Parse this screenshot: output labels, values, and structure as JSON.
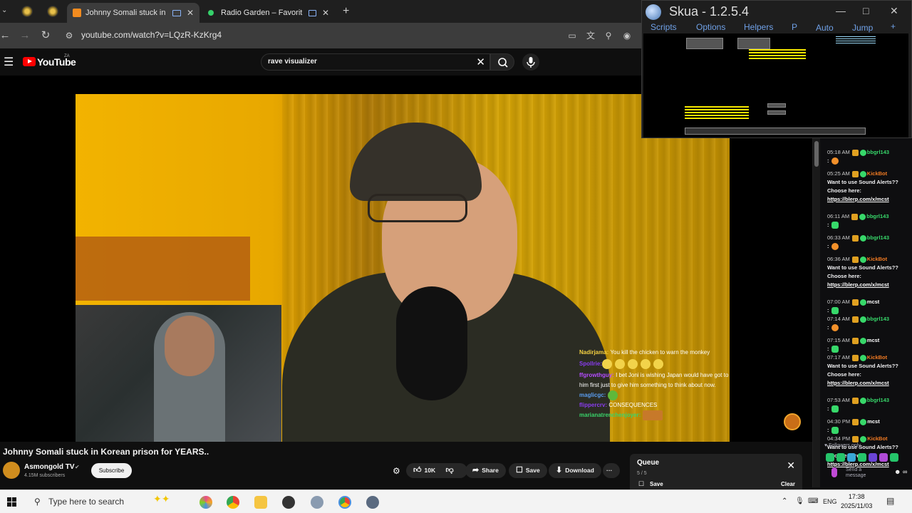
{
  "browser": {
    "tabs": [
      {
        "title": "Johnny Somali stuck in Kor",
        "active": true
      },
      {
        "title": "Radio Garden – Favorites",
        "active": false
      }
    ],
    "url": "youtube.com/watch?v=LQzR-KzKrg4"
  },
  "youtube": {
    "logo_text": "YouTube",
    "region": "ZA",
    "search_value": "rave visualizer"
  },
  "video": {
    "title": "Johnny Somali stuck in Korean prison for YEARS..",
    "channel": "Asmongold TV",
    "verified_icon": "✔",
    "subscribers": "4.15M subscribers",
    "subscribe_label": "Subscribe",
    "likes": "10K",
    "share_label": "Share",
    "save_label": "Save",
    "download_label": "Download",
    "more_label": "···"
  },
  "overlay_chat": [
    {
      "name": "Nadirjama:",
      "text": " You kill the chicken to warn the monkey",
      "color": "#f5d142"
    },
    {
      "name": "Spollrie:",
      "text": "",
      "color": "#8a3cf0"
    },
    {
      "name": "ffgrowthguy:",
      "text": " I bet Joni is wishing Japan would have got to him first just to give him something to think about now.",
      "color": "#b44cff"
    },
    {
      "name": "maglicgc:",
      "text": "",
      "color": "#5a9df0"
    },
    {
      "name": "flippercrv:",
      "text": " CONSEQUENCES",
      "color": "#8a3cf0"
    },
    {
      "name": "marianatrenchenjoyer:",
      "text": "",
      "color": "#39d46a"
    }
  ],
  "chat_panel": {
    "messages": [
      {
        "time": "05:18 AM",
        "user": "bbgrl143",
        "user_color": "#37d86a",
        "body": ":",
        "link": "",
        "emote": "heart"
      },
      {
        "time": "05:25 AM",
        "user": "KickBot",
        "user_color": "#f07a22",
        "body": "Want to use Sound Alerts?? Choose here:",
        "link": "https://blerp.com/x/mcst",
        "emote": ""
      },
      {
        "time": "06:11 AM",
        "user": "bbgrl143",
        "user_color": "#37d86a",
        "body": ":",
        "link": "",
        "emote": "green"
      },
      {
        "time": "06:33 AM",
        "user": "bbgrl143",
        "user_color": "#37d86a",
        "body": ":",
        "link": "",
        "emote": "heart"
      },
      {
        "time": "06:36 AM",
        "user": "KickBot",
        "user_color": "#f07a22",
        "body": "Want to use Sound Alerts?? Choose here:",
        "link": "https://blerp.com/x/mcst",
        "emote": ""
      },
      {
        "time": "07:00 AM",
        "user": "mcst",
        "user_color": "#ffffff",
        "body": ":",
        "link": "",
        "emote": "green"
      },
      {
        "time": "07:14 AM",
        "user": "bbgrl143",
        "user_color": "#37d86a",
        "body": ":",
        "link": "",
        "emote": "heart"
      },
      {
        "time": "07:15 AM",
        "user": "mcst",
        "user_color": "#ffffff",
        "body": ":",
        "link": "",
        "emote": "green"
      },
      {
        "time": "07:17 AM",
        "user": "KickBot",
        "user_color": "#f07a22",
        "body": "Want to use Sound Alerts?? Choose here:",
        "link": "https://blerp.com/x/mcst",
        "emote": ""
      },
      {
        "time": "07:53 AM",
        "user": "bbgrl143",
        "user_color": "#37d86a",
        "body": ":",
        "link": "",
        "emote": "green"
      },
      {
        "time": "04:30 PM",
        "user": "mcst",
        "user_color": "#ffffff",
        "body": ":",
        "link": "",
        "emote": "green"
      },
      {
        "time": "04:34 PM",
        "user": "KickBot",
        "user_color": "#f07a22",
        "body": "Want to use Sound Alerts?? Choose here:",
        "link": "https://blerp.com/x/mcst",
        "emote": ""
      }
    ],
    "followers_only": "Followers only",
    "send_placeholder": "Send a message"
  },
  "skua": {
    "title": "Skua - 1.2.5.4",
    "menu": [
      "Scripts",
      "Options",
      "Helpers",
      "P",
      "Auto",
      "Jump",
      "+"
    ]
  },
  "queue": {
    "title": "Queue",
    "count": "5 / 5",
    "save_label": "Save",
    "clear_label": "Clear"
  },
  "taskbar": {
    "search_placeholder": "Type here to search",
    "language": "ENG",
    "time": "17:38",
    "date": "2025/11/03"
  }
}
